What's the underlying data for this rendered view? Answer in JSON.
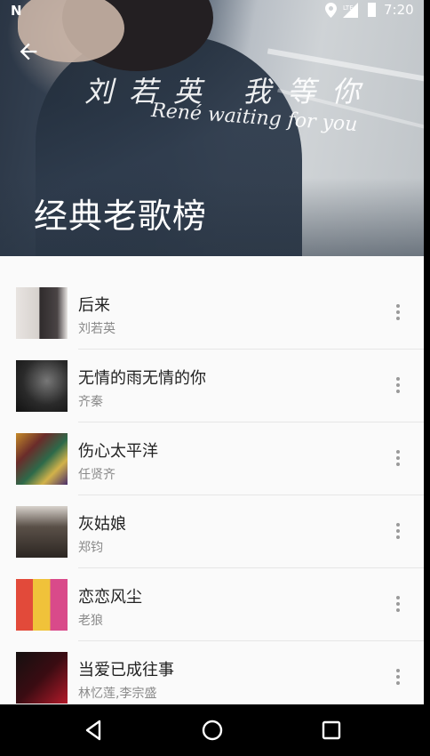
{
  "status_bar": {
    "carrier_logo": "N",
    "network": "LTE",
    "time": "7:20",
    "icons": [
      "location-icon",
      "signal-icon",
      "battery-icon"
    ]
  },
  "header": {
    "back_icon": "arrow-back-icon",
    "album_art_text": "刘若英 我等你",
    "album_art_subtext": "René waiting for you",
    "title": "经典老歌榜"
  },
  "songs": [
    {
      "title": "后来",
      "artist": "刘若英"
    },
    {
      "title": "无情的雨无情的你",
      "artist": "齐秦"
    },
    {
      "title": "伤心太平洋",
      "artist": "任贤齐"
    },
    {
      "title": "灰姑娘",
      "artist": "郑钧"
    },
    {
      "title": "恋恋风尘",
      "artist": "老狼"
    },
    {
      "title": "当爱已成往事",
      "artist": "林忆莲,李宗盛"
    }
  ],
  "nav_bar": {
    "icons": [
      "back-triangle-icon",
      "home-circle-icon",
      "recents-square-icon"
    ]
  },
  "colors": {
    "list_background": "#fafafa",
    "title_text": "#222222",
    "subtitle_text": "#8a8a8a",
    "nav_background": "#000000"
  }
}
